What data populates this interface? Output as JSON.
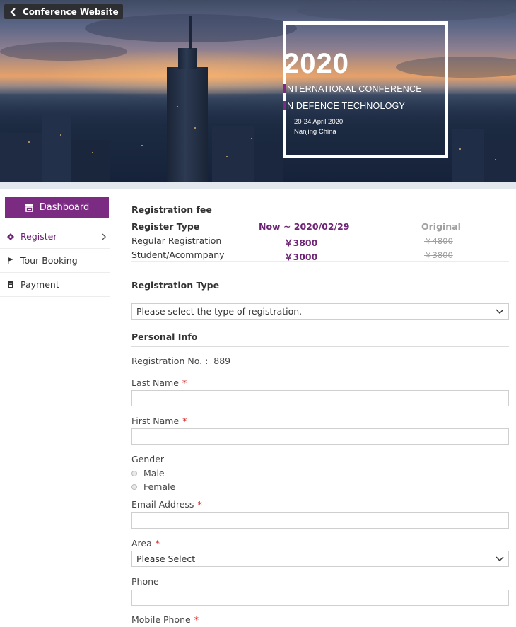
{
  "banner": {
    "back_label": "Conference Website",
    "year": "2020",
    "conf_line1": "NTERNATIONAL CONFERENCE",
    "conf_line2": "N DEFENCE TECHNOLOGY",
    "dates": "20-24 April 2020",
    "place": "Nanjing China"
  },
  "sidebar": {
    "dashboard_label": "Dashboard",
    "items": [
      {
        "label": "Register",
        "icon": "ticket-icon"
      },
      {
        "label": "Tour Booking",
        "icon": "flag-icon"
      },
      {
        "label": "Payment",
        "icon": "wallet-icon"
      }
    ]
  },
  "fee": {
    "title": "Registration fee",
    "headers": [
      "Register Type",
      "Now ~ 2020/02/29",
      "Original"
    ],
    "rows": [
      {
        "type": "Regular Registration",
        "now": "￥3800",
        "original": "￥4800"
      },
      {
        "type": "Student/Acommpany",
        "now": "￥3000",
        "original": "￥3800"
      }
    ]
  },
  "registration_type": {
    "title": "Registration Type",
    "selected": "Please select the type of registration."
  },
  "personal": {
    "title": "Personal Info",
    "reg_no_label": "Registration No. :",
    "reg_no": "889",
    "last_name_label": "Last Name",
    "first_name_label": "First Name",
    "gender_label": "Gender",
    "gender_options": [
      "Male",
      "Female"
    ],
    "email_label": "Email Address",
    "area_label": "Area",
    "area_selected": "Please Select",
    "phone_label": "Phone",
    "mobile_label": "Mobile Phone",
    "required_mark": "*"
  },
  "colors": {
    "accent": "#7b2b82",
    "required": "#d62020"
  }
}
